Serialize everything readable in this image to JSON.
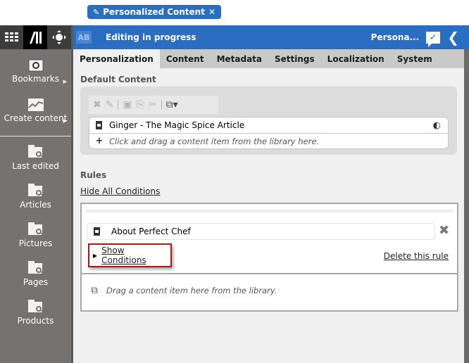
{
  "document_tab": {
    "icon": "pencil-icon",
    "label": "Personalized Content",
    "close_icon": "close-icon"
  },
  "rail": {
    "top_buttons": [
      {
        "name": "apps-grid-icon"
      },
      {
        "name": "library-icon"
      },
      {
        "name": "navigator-icon"
      }
    ],
    "items": [
      {
        "label": "Bookmarks",
        "icon": "bookmarks-icon",
        "has_submenu": true
      },
      {
        "label": "Create content",
        "icon": "create-content-icon",
        "has_submenu": true
      },
      {
        "label": "Last edited",
        "icon": "folder-search-icon"
      },
      {
        "label": "Articles",
        "icon": "folder-search-icon"
      },
      {
        "label": "Pictures",
        "icon": "folder-search-icon"
      },
      {
        "label": "Pages",
        "icon": "folder-search-icon"
      },
      {
        "label": "Products",
        "icon": "folder-search-icon"
      }
    ]
  },
  "header": {
    "badge": "AB",
    "title": "Editing in progress",
    "short_name": "Persona...",
    "approve_icon": "check-comment-icon",
    "back_icon": "chevron-left-icon"
  },
  "tabs": [
    {
      "label": "Personalization",
      "active": true
    },
    {
      "label": "Content"
    },
    {
      "label": "Metadata"
    },
    {
      "label": "Settings"
    },
    {
      "label": "Localization"
    },
    {
      "label": "System"
    }
  ],
  "default_content": {
    "heading": "Default Content",
    "toolbar": [
      "remove",
      "edit",
      "save",
      "copy",
      "cut",
      "add-new"
    ],
    "item": "Ginger - The Magic Spice Article",
    "placeholder": "Click and drag a content item from the library here."
  },
  "rules": {
    "heading": "Rules",
    "hide_all_label": "Hide All Conditions",
    "rule": {
      "item": "About Perfect Chef",
      "show_conditions_label": "Show Conditions",
      "delete_label": "Delete this rule"
    },
    "drop_hint": "Drag a content item here from the library."
  }
}
